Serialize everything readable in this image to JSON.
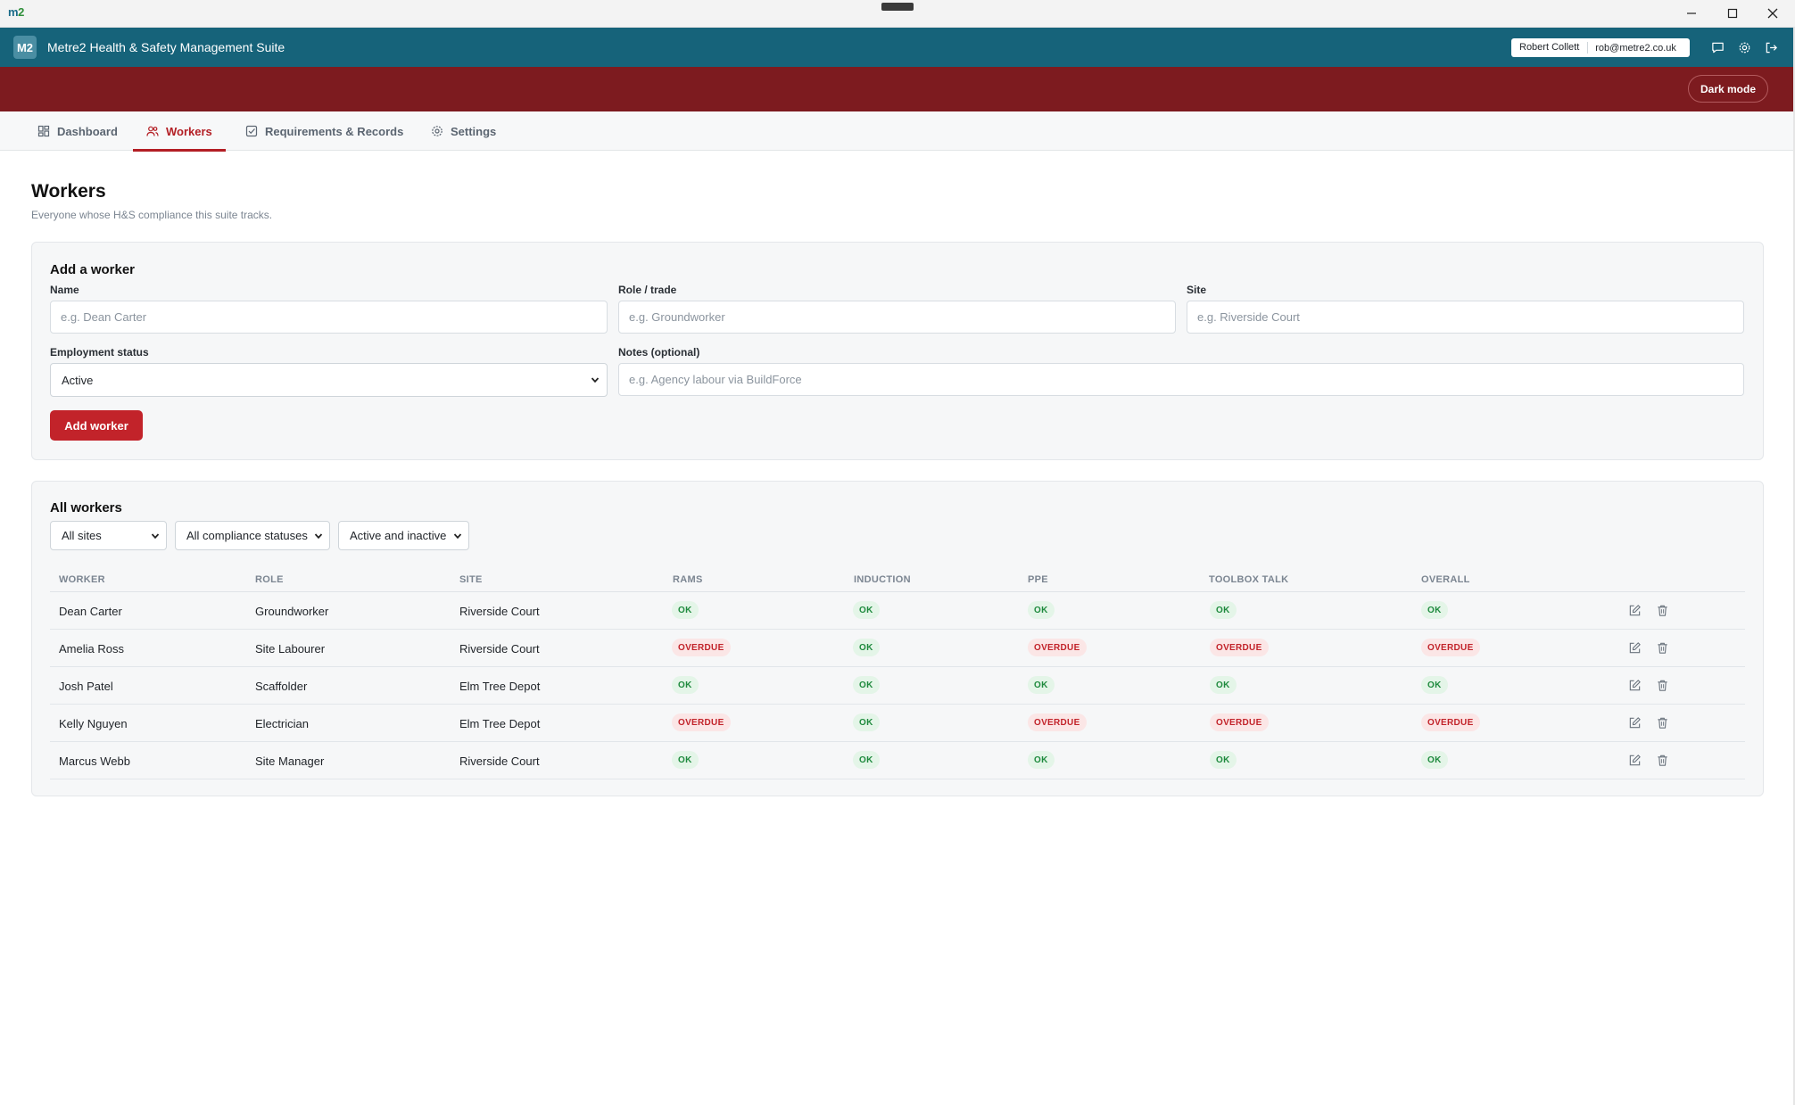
{
  "os": {
    "logo_m": "m",
    "logo_2": "2"
  },
  "header": {
    "logo": "M2",
    "title": "Metre2 Health & Safety Management Suite",
    "user_name": "Robert Collett",
    "user_email": "rob@metre2.co.uk",
    "dark_mode_label": "Dark mode"
  },
  "tabs": [
    {
      "label": "Dashboard",
      "icon": "dashboard-icon"
    },
    {
      "label": "Workers",
      "icon": "users-icon",
      "active": true
    },
    {
      "label": "Requirements & Records",
      "icon": "checklist-icon"
    },
    {
      "label": "Settings",
      "icon": "gear-icon"
    }
  ],
  "page": {
    "title": "Workers",
    "subtitle": "Everyone whose H&S compliance this suite tracks."
  },
  "add_form": {
    "title": "Add a worker",
    "name_label": "Name",
    "name_placeholder": "e.g. Dean Carter",
    "role_label": "Role / trade",
    "role_placeholder": "e.g. Groundworker",
    "site_label": "Site",
    "site_placeholder": "e.g. Riverside Court",
    "status_label": "Employment status",
    "status_value": "Active",
    "notes_label": "Notes (optional)",
    "notes_placeholder": "e.g. Agency labour via BuildForce",
    "submit_label": "Add worker"
  },
  "list": {
    "title": "All workers",
    "filter_sites": "All sites",
    "filter_compliance": "All compliance statuses",
    "filter_active": "Active and inactive",
    "columns": [
      "WORKER",
      "ROLE",
      "SITE",
      "RAMS",
      "INDUCTION",
      "PPE",
      "TOOLBOX TALK",
      "OVERALL"
    ],
    "rows": [
      {
        "worker": "Dean Carter",
        "role": "Groundworker",
        "site": "Riverside Court",
        "rams": "OK",
        "induction": "OK",
        "ppe": "OK",
        "toolbox": "OK",
        "overall": "OK"
      },
      {
        "worker": "Amelia Ross",
        "role": "Site Labourer",
        "site": "Riverside Court",
        "rams": "OVERDUE",
        "induction": "OK",
        "ppe": "OVERDUE",
        "toolbox": "OVERDUE",
        "overall": "OVERDUE"
      },
      {
        "worker": "Josh Patel",
        "role": "Scaffolder",
        "site": "Elm Tree Depot",
        "rams": "OK",
        "induction": "OK",
        "ppe": "OK",
        "toolbox": "OK",
        "overall": "OK"
      },
      {
        "worker": "Kelly Nguyen",
        "role": "Electrician",
        "site": "Elm Tree Depot",
        "rams": "OVERDUE",
        "induction": "OK",
        "ppe": "OVERDUE",
        "toolbox": "OVERDUE",
        "overall": "OVERDUE"
      },
      {
        "worker": "Marcus Webb",
        "role": "Site Manager",
        "site": "Riverside Court",
        "rams": "OK",
        "induction": "OK",
        "ppe": "OK",
        "toolbox": "OK",
        "overall": "OK"
      }
    ]
  },
  "colors": {
    "header": "#16637a",
    "banner": "#7d1b1f",
    "accent": "#c2232a",
    "ok": "#1e8a3d",
    "overdue": "#c2232a"
  }
}
